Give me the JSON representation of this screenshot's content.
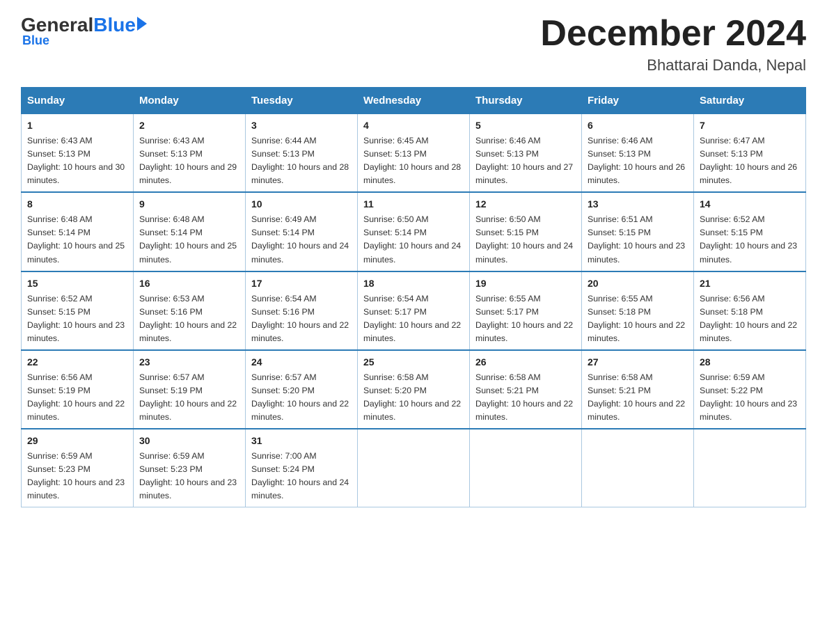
{
  "header": {
    "logo_general": "General",
    "logo_blue": "Blue",
    "month_title": "December 2024",
    "location": "Bhattarai Danda, Nepal"
  },
  "days_of_week": [
    "Sunday",
    "Monday",
    "Tuesday",
    "Wednesday",
    "Thursday",
    "Friday",
    "Saturday"
  ],
  "weeks": [
    [
      {
        "day": "1",
        "sunrise": "6:43 AM",
        "sunset": "5:13 PM",
        "daylight": "10 hours and 30 minutes."
      },
      {
        "day": "2",
        "sunrise": "6:43 AM",
        "sunset": "5:13 PM",
        "daylight": "10 hours and 29 minutes."
      },
      {
        "day": "3",
        "sunrise": "6:44 AM",
        "sunset": "5:13 PM",
        "daylight": "10 hours and 28 minutes."
      },
      {
        "day": "4",
        "sunrise": "6:45 AM",
        "sunset": "5:13 PM",
        "daylight": "10 hours and 28 minutes."
      },
      {
        "day": "5",
        "sunrise": "6:46 AM",
        "sunset": "5:13 PM",
        "daylight": "10 hours and 27 minutes."
      },
      {
        "day": "6",
        "sunrise": "6:46 AM",
        "sunset": "5:13 PM",
        "daylight": "10 hours and 26 minutes."
      },
      {
        "day": "7",
        "sunrise": "6:47 AM",
        "sunset": "5:13 PM",
        "daylight": "10 hours and 26 minutes."
      }
    ],
    [
      {
        "day": "8",
        "sunrise": "6:48 AM",
        "sunset": "5:14 PM",
        "daylight": "10 hours and 25 minutes."
      },
      {
        "day": "9",
        "sunrise": "6:48 AM",
        "sunset": "5:14 PM",
        "daylight": "10 hours and 25 minutes."
      },
      {
        "day": "10",
        "sunrise": "6:49 AM",
        "sunset": "5:14 PM",
        "daylight": "10 hours and 24 minutes."
      },
      {
        "day": "11",
        "sunrise": "6:50 AM",
        "sunset": "5:14 PM",
        "daylight": "10 hours and 24 minutes."
      },
      {
        "day": "12",
        "sunrise": "6:50 AM",
        "sunset": "5:15 PM",
        "daylight": "10 hours and 24 minutes."
      },
      {
        "day": "13",
        "sunrise": "6:51 AM",
        "sunset": "5:15 PM",
        "daylight": "10 hours and 23 minutes."
      },
      {
        "day": "14",
        "sunrise": "6:52 AM",
        "sunset": "5:15 PM",
        "daylight": "10 hours and 23 minutes."
      }
    ],
    [
      {
        "day": "15",
        "sunrise": "6:52 AM",
        "sunset": "5:15 PM",
        "daylight": "10 hours and 23 minutes."
      },
      {
        "day": "16",
        "sunrise": "6:53 AM",
        "sunset": "5:16 PM",
        "daylight": "10 hours and 22 minutes."
      },
      {
        "day": "17",
        "sunrise": "6:54 AM",
        "sunset": "5:16 PM",
        "daylight": "10 hours and 22 minutes."
      },
      {
        "day": "18",
        "sunrise": "6:54 AM",
        "sunset": "5:17 PM",
        "daylight": "10 hours and 22 minutes."
      },
      {
        "day": "19",
        "sunrise": "6:55 AM",
        "sunset": "5:17 PM",
        "daylight": "10 hours and 22 minutes."
      },
      {
        "day": "20",
        "sunrise": "6:55 AM",
        "sunset": "5:18 PM",
        "daylight": "10 hours and 22 minutes."
      },
      {
        "day": "21",
        "sunrise": "6:56 AM",
        "sunset": "5:18 PM",
        "daylight": "10 hours and 22 minutes."
      }
    ],
    [
      {
        "day": "22",
        "sunrise": "6:56 AM",
        "sunset": "5:19 PM",
        "daylight": "10 hours and 22 minutes."
      },
      {
        "day": "23",
        "sunrise": "6:57 AM",
        "sunset": "5:19 PM",
        "daylight": "10 hours and 22 minutes."
      },
      {
        "day": "24",
        "sunrise": "6:57 AM",
        "sunset": "5:20 PM",
        "daylight": "10 hours and 22 minutes."
      },
      {
        "day": "25",
        "sunrise": "6:58 AM",
        "sunset": "5:20 PM",
        "daylight": "10 hours and 22 minutes."
      },
      {
        "day": "26",
        "sunrise": "6:58 AM",
        "sunset": "5:21 PM",
        "daylight": "10 hours and 22 minutes."
      },
      {
        "day": "27",
        "sunrise": "6:58 AM",
        "sunset": "5:21 PM",
        "daylight": "10 hours and 22 minutes."
      },
      {
        "day": "28",
        "sunrise": "6:59 AM",
        "sunset": "5:22 PM",
        "daylight": "10 hours and 23 minutes."
      }
    ],
    [
      {
        "day": "29",
        "sunrise": "6:59 AM",
        "sunset": "5:23 PM",
        "daylight": "10 hours and 23 minutes."
      },
      {
        "day": "30",
        "sunrise": "6:59 AM",
        "sunset": "5:23 PM",
        "daylight": "10 hours and 23 minutes."
      },
      {
        "day": "31",
        "sunrise": "7:00 AM",
        "sunset": "5:24 PM",
        "daylight": "10 hours and 24 minutes."
      },
      null,
      null,
      null,
      null
    ]
  ]
}
